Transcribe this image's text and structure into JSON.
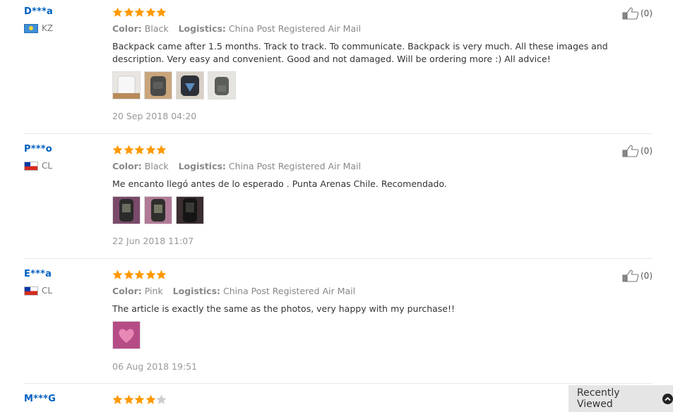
{
  "reviews": [
    {
      "user": "D***a",
      "country": "KZ",
      "flag": "kz-flag",
      "rating": 5,
      "color_label": "Color:",
      "color_value": "Black",
      "logistics_label": "Logistics:",
      "logistics_value": "China Post Registered Air Mail",
      "text": "Backpack came after 1.5 months. Track to track. To communicate. Backpack is very much. All these images and description. Very easy and convenient. Good and not damaged. Will be ordering more :) All advice!",
      "photos": 4,
      "date": "20 Sep 2018 04:20",
      "likes": "(0)"
    },
    {
      "user": "P***o",
      "country": "CL",
      "flag": "cl-flag",
      "rating": 5,
      "color_label": "Color:",
      "color_value": "Black",
      "logistics_label": "Logistics:",
      "logistics_value": "China Post Registered Air Mail",
      "text": "Me encanto llegó antes de lo esperado . Punta Arenas Chile. Recomendado.",
      "photos": 3,
      "date": "22 Jun 2018 11:07",
      "likes": "(0)"
    },
    {
      "user": "E***a",
      "country": "CL",
      "flag": "cl-flag",
      "rating": 5,
      "color_label": "Color:",
      "color_value": "Pink",
      "logistics_label": "Logistics:",
      "logistics_value": "China Post Registered Air Mail",
      "text": "The article is exactly the same as the photos, very happy with my purchase!!",
      "photos": 1,
      "date": "06 Aug 2018 19:51",
      "likes": "(0)"
    },
    {
      "user": "M***G",
      "rating": 4
    }
  ],
  "recently_viewed": {
    "label": "Recently Viewed",
    "icon": "chevron-up-icon"
  },
  "colors": {
    "star": "#f90",
    "star_empty": "#ccc",
    "username": "#0060c0",
    "recent_bg": "#e5e5e5"
  }
}
